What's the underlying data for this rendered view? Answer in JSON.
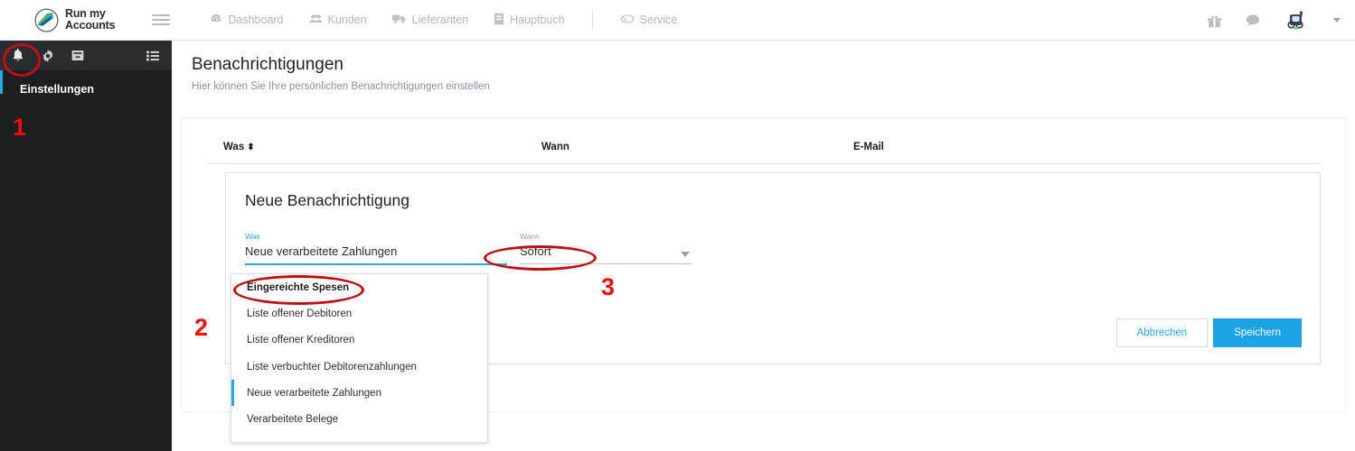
{
  "topbar": {
    "logo": {
      "line1": "Run my",
      "line2": "Accounts",
      "icon": "logo-swoosh-icon"
    },
    "menu_icon": "hamburger-icon",
    "nav": [
      {
        "label": "Dashboard",
        "icon": "dashboard-icon"
      },
      {
        "label": "Kunden",
        "icon": "users-icon"
      },
      {
        "label": "Lieferanten",
        "icon": "truck-icon"
      },
      {
        "label": "Hauptbuch",
        "icon": "book-icon"
      },
      {
        "label": "Service",
        "icon": "service-icon"
      }
    ],
    "right_icons": [
      {
        "name": "gift-icon"
      },
      {
        "name": "chat-bubble-icon"
      },
      {
        "name": "avatar-icon"
      },
      {
        "name": "chevron-down-icon"
      }
    ]
  },
  "sidebar": {
    "icons": [
      {
        "name": "bell-icon"
      },
      {
        "name": "gear-icon"
      },
      {
        "name": "archive-icon"
      },
      {
        "name": "list-icon"
      }
    ],
    "label": "Einstellungen"
  },
  "page": {
    "title": "Benachrichtigungen",
    "subtitle": "Hier können Sie Ihre persönlichen Benachrichtigungen einstellen"
  },
  "table": {
    "headers": [
      {
        "label": "Was",
        "sort_glyph": "⬍"
      },
      {
        "label": "Wann",
        "sort_glyph": ""
      },
      {
        "label": "E-Mail",
        "sort_glyph": ""
      }
    ]
  },
  "form": {
    "title": "Neue Benachrichtigung",
    "fields": [
      {
        "label": "Was",
        "value": "Neue verarbeitete Zahlungen"
      },
      {
        "label": "Wann",
        "value": "Sofort"
      }
    ],
    "buttons": {
      "cancel": "Abbrechen",
      "save": "Speichern"
    }
  },
  "dropdown": {
    "options": [
      "Eingereichte Spesen",
      "Liste offener Debitoren",
      "Liste offener Kreditoren",
      "Liste verbuchter Debitorenzahlungen",
      "Neue verarbeitete Zahlungen",
      "Verarbeitete Belege"
    ],
    "selected": "Neue verarbeitete Zahlungen"
  },
  "annotations": [
    {
      "number": "1"
    },
    {
      "number": "2"
    },
    {
      "number": "3"
    }
  ],
  "colors": {
    "accent_blue": "#1ba3e8",
    "link_blue": "#2aa7e0",
    "sidebar_dark": "#1c1f21",
    "annotation_red": "#fb0a0a",
    "page_bg": "#e3e3e3"
  }
}
